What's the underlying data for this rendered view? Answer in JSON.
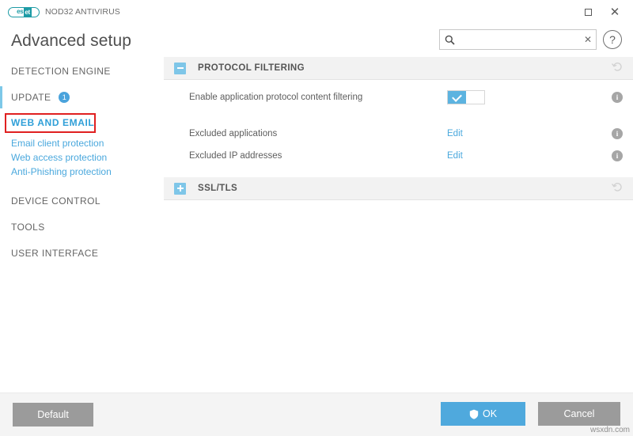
{
  "window": {
    "product_name": "NOD32 ANTIVIRUS",
    "logo_text_a": "es",
    "logo_text_b": "et",
    "maximize_label": "",
    "close_label": "✕"
  },
  "header": {
    "title": "Advanced setup",
    "help_label": "?"
  },
  "search": {
    "value": "",
    "placeholder": "",
    "clear_label": "✕"
  },
  "sidebar": {
    "items": [
      {
        "label": "DETECTION ENGINE"
      },
      {
        "label": "UPDATE",
        "badge": "1"
      },
      {
        "label": "WEB AND EMAIL"
      },
      {
        "label": "DEVICE CONTROL"
      },
      {
        "label": "TOOLS"
      },
      {
        "label": "USER INTERFACE"
      }
    ],
    "subitems": [
      {
        "label": "Email client protection"
      },
      {
        "label": "Web access protection"
      },
      {
        "label": "Anti-Phishing protection"
      }
    ]
  },
  "content": {
    "sections": [
      {
        "title": "PROTOCOL FILTERING",
        "expanded": true,
        "collapse_glyph": "minus"
      },
      {
        "title": "SSL/TLS",
        "expanded": false,
        "collapse_glyph": "plus"
      }
    ],
    "rows": [
      {
        "label": "Enable application protocol content filtering",
        "control": "switch",
        "state": "on",
        "info": "i"
      },
      {
        "label": "Excluded applications",
        "control": "link",
        "link_label": "Edit",
        "info": "i"
      },
      {
        "label": "Excluded IP addresses",
        "control": "link",
        "link_label": "Edit",
        "info": "i"
      }
    ]
  },
  "footer": {
    "default_label": "Default",
    "ok_label": "OK",
    "cancel_label": "Cancel"
  },
  "watermark": {
    "text": "wsxdn.com"
  },
  "colors": {
    "accent_blue": "#4aa8dd",
    "toggle_blue": "#7ec6e8",
    "switch_on": "#5cb3e0",
    "eset_teal": "#1d9ba5",
    "highlight_red": "#e02020",
    "button_gray": "#9b9b9b",
    "section_bg": "#f2f2f2"
  }
}
